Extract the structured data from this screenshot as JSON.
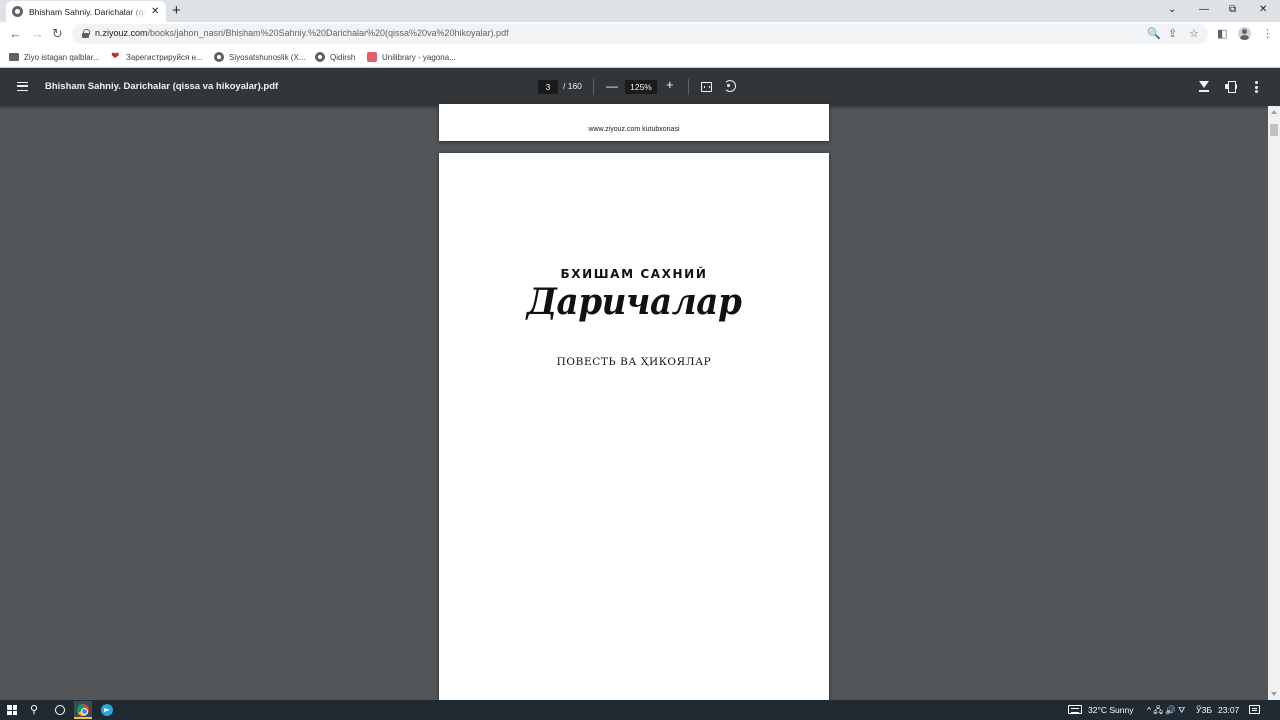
{
  "browser": {
    "tab_title": "Bhisham Sahniy. Darichalar (qissa va hikoyalar).pdf",
    "tab_close": "✕",
    "new_tab": "+",
    "window_controls": {
      "tab_search": "⌄",
      "minimize": "—",
      "restore": "⧉",
      "close": "✕"
    },
    "url_host": "n.ziyouz.com",
    "url_path": "/books/jahon_nasri/Bhisham%20Sahniy.%20Darichalar%20(qissa%20va%20hikoyalar).pdf",
    "nav": {
      "back": "←",
      "forward": "→",
      "reload": "↻"
    },
    "omnibox_icons": {
      "zoom": "🔍",
      "share": "⇪",
      "bookmark": "☆"
    },
    "toolbar_icons": {
      "side_panel": "◧",
      "menu": "⋮"
    }
  },
  "bookmarks": [
    {
      "icon": "folder-icon",
      "label": "Ziyo istagan qalblar..."
    },
    {
      "icon": "heart-icon",
      "label": "Зарегистрируйся н..."
    },
    {
      "icon": "globe-icon",
      "label": "Siyosatshunoslik (X..."
    },
    {
      "icon": "globe-icon",
      "label": "Qidirsh"
    },
    {
      "icon": "book-icon",
      "label": "Unilibrary - yagona..."
    }
  ],
  "pdf_viewer": {
    "title": "Bhisham Sahniy. Darichalar (qissa va hikoyalar).pdf",
    "current_page": "3",
    "total_pages": "/ 160",
    "zoom": "125%",
    "zoom_out": "—",
    "zoom_in": "+",
    "more": "⋮"
  },
  "document": {
    "prev_page_footer": "www.ziyouz.com kutubxonasi",
    "author": "БХИШАМ САХНИЙ",
    "title": "Даричалар",
    "subtitle": "ПОВЕСТЬ ВА ҲИКОЯЛАР"
  },
  "taskbar": {
    "search_glyph": "⚲",
    "weather": "32°C  Sunny",
    "tray_icons": "^  🖧  🔊  ⛛",
    "language": "ЎЗБ",
    "time": "23:07"
  },
  "colors": {
    "tab_strip": "#dee1e6",
    "pdf_toolbar": "#323639",
    "viewer_background": "#525659",
    "taskbar": "#1f2a33"
  }
}
